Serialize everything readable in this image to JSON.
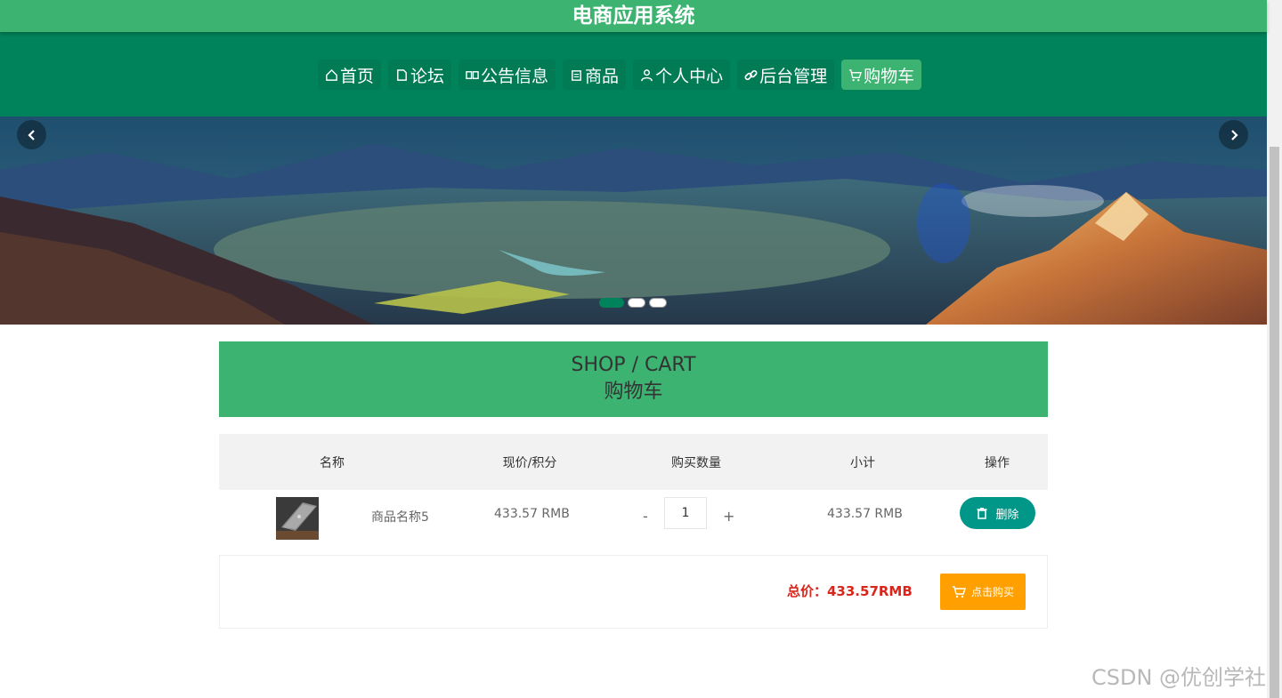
{
  "header": {
    "title": "电商应用系统"
  },
  "nav": {
    "items": [
      {
        "label": "首页",
        "icon": "home-icon"
      },
      {
        "label": "论坛",
        "icon": "forum-icon"
      },
      {
        "label": "公告信息",
        "icon": "notice-icon"
      },
      {
        "label": "商品",
        "icon": "goods-icon"
      },
      {
        "label": "个人中心",
        "icon": "user-icon"
      },
      {
        "label": "后台管理",
        "icon": "link-icon"
      },
      {
        "label": "购物车",
        "icon": "cart-icon"
      }
    ],
    "active": "购物车"
  },
  "banner": {
    "slide_count": 3,
    "active_slide": 1
  },
  "section": {
    "en_title": "SHOP / CART",
    "cn_title": "购物车"
  },
  "table": {
    "headers": {
      "name": "名称",
      "price": "现价/积分",
      "qty": "购买数量",
      "subtotal": "小计",
      "action": "操作"
    },
    "rows": [
      {
        "name": "商品名称5",
        "price": "433.57 RMB",
        "qty_minus": "-",
        "qty": "1",
        "qty_plus": "+",
        "subtotal": "433.57 RMB",
        "delete_label": "删除"
      }
    ]
  },
  "summary": {
    "total_label": "总价：433.57RMB",
    "buy_label": "点击购买"
  },
  "watermark": "CSDN @优创学社",
  "colors": {
    "brand_green": "#3cb371",
    "nav_green": "#00835a",
    "teal": "#009688",
    "orange": "#ff9f00",
    "price_red": "#d9251c"
  }
}
